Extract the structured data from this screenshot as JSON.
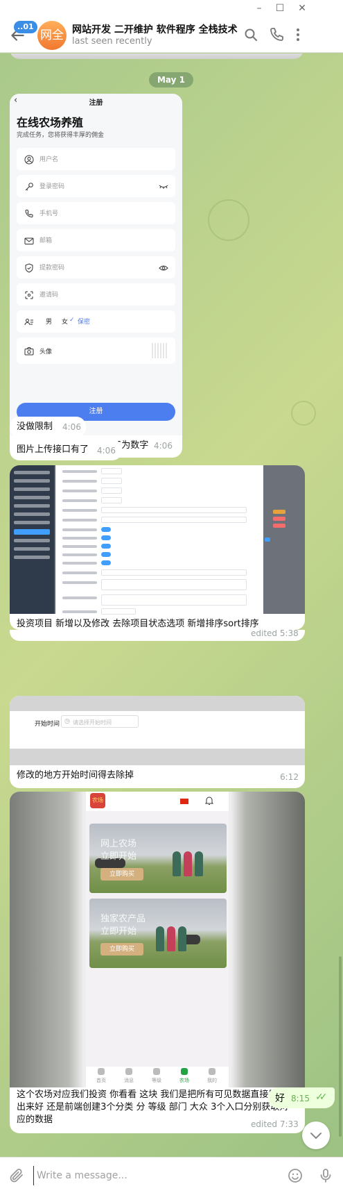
{
  "window": {
    "minimize": "–",
    "maximize": "☐",
    "close": "✕"
  },
  "header": {
    "unread_badge": "..01",
    "avatar_text": "网全",
    "title": "网站开发 二开维护 软件程序 全栈技术",
    "status": "last seen recently",
    "icons": [
      "back-arrow-icon",
      "search-icon",
      "phone-icon",
      "more-vertical-icon"
    ]
  },
  "date_chip": "May 1",
  "messages": {
    "reg_form": {
      "nav_title": "注册",
      "heading": "在线农场养殖",
      "subheading": "完成任务，您将获得丰厚的佣金",
      "fields": {
        "username": "用户名",
        "login_password": "登录密码",
        "phone": "手机号",
        "email": "邮箱",
        "withdraw_password": "提款密码",
        "invite_code": "邀请码",
        "avatar": "头像"
      },
      "gender": {
        "male": "男",
        "female": "女",
        "secret": "保密",
        "selected": "secret"
      },
      "submit": "注册",
      "caption": "注册这块安全密码应该是6为数字",
      "time": "4:06"
    },
    "no_limit": {
      "text": "没做限制",
      "time": "4:06"
    },
    "upload_api": {
      "text": "图片上传接口有了",
      "time": "4:06"
    },
    "invest": {
      "text": "投资项目 新增以及修改 去除项目状态选项 新增排序sort排序",
      "time": "edited 5:38"
    },
    "start_time": {
      "label": "开始时间",
      "placeholder": "请选择开始时间",
      "text": "修改的地方开始时间得去除掉",
      "time": "6:12"
    },
    "farm": {
      "logo_text": "农场",
      "card1_line1": "网上农场",
      "card1_line2": "立即开始",
      "card2_line1": "独家农产品",
      "card2_line2": "立即开始",
      "buy_label": "立即购买",
      "tabs": [
        "首页",
        "消息",
        "等级",
        "农场",
        "我的"
      ],
      "active_tab": 3,
      "text": "这个农场对应我们投资 你看看 这块 我们是把所有可见数据直接展示出来好 还是前端创建3个分类 分 等级 部门 大众 3个入口分别获取对应的数据",
      "time": "edited 7:33"
    },
    "reply": {
      "text": "好",
      "time": "8:15",
      "status": "read"
    }
  },
  "composer": {
    "placeholder": "Write a message..."
  },
  "colors": {
    "accent": "#3a8ee6",
    "outgoing": "#eeffde",
    "submit": "#4d7ef0",
    "active_tab": "#25a244"
  }
}
